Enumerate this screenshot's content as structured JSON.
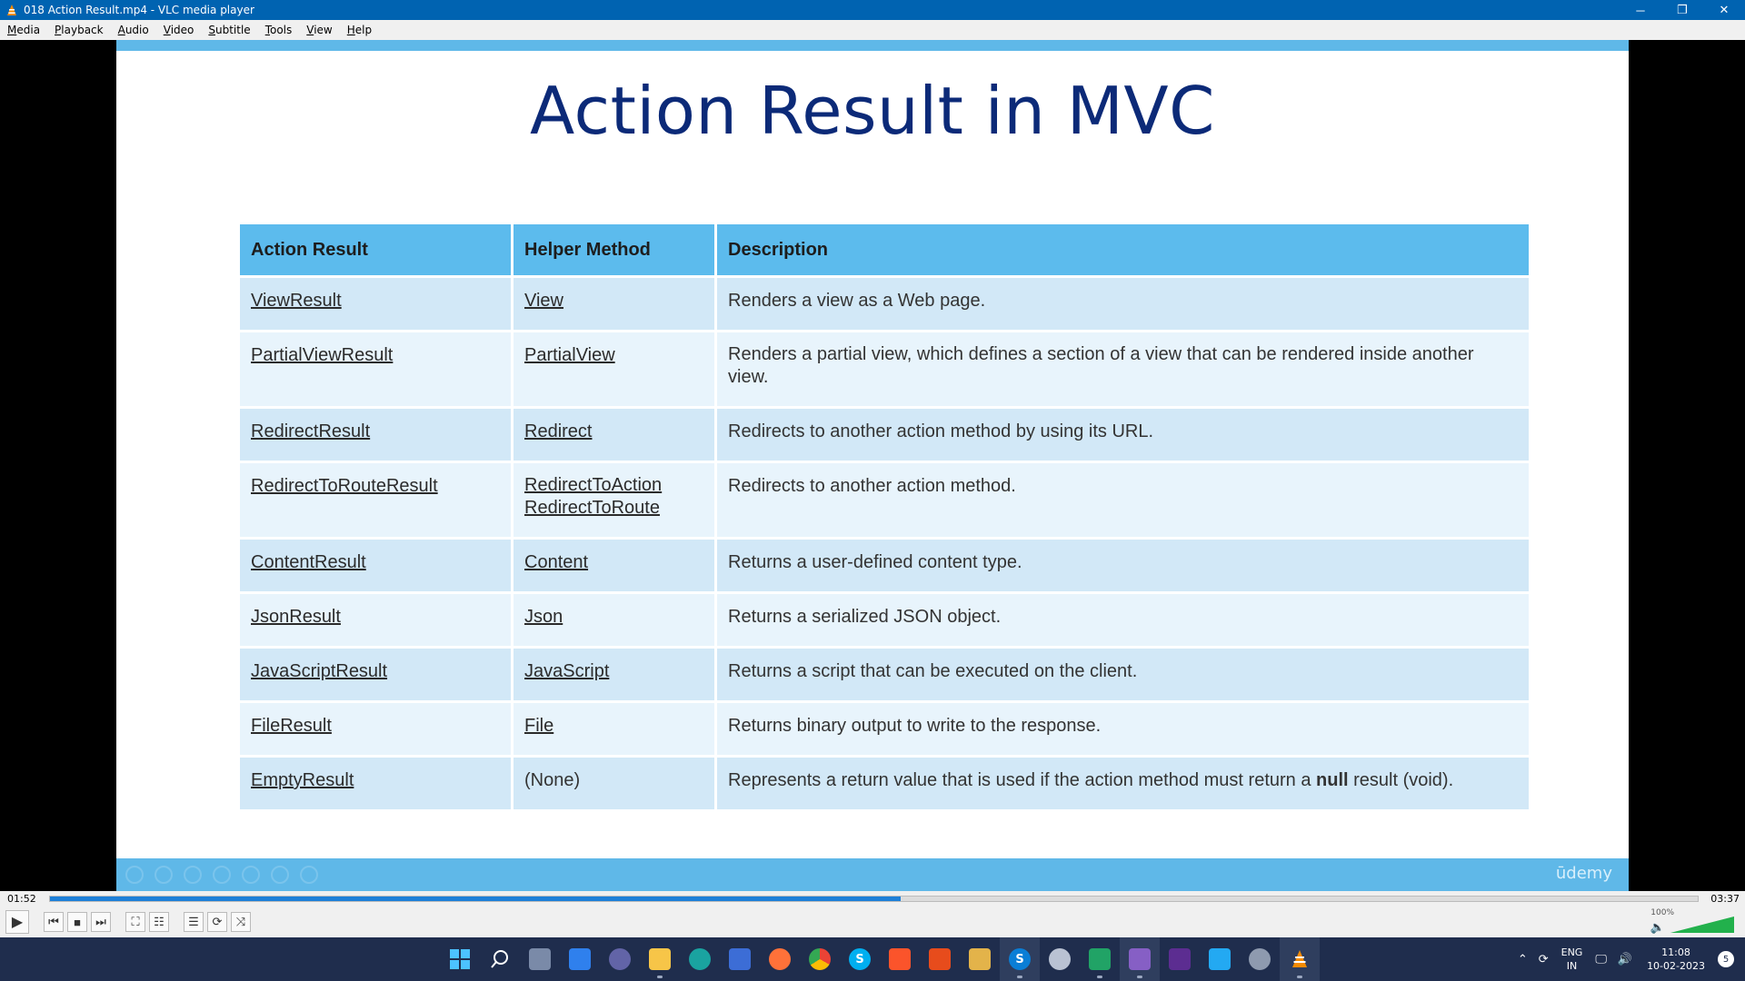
{
  "window": {
    "title": "018 Action Result.mp4 - VLC media player",
    "minimize_glyph": "─",
    "restore_glyph": "❐",
    "close_glyph": "✕"
  },
  "menu": [
    "Media",
    "Playback",
    "Audio",
    "Video",
    "Subtitle",
    "Tools",
    "View",
    "Help"
  ],
  "slide": {
    "title": "Action Result in MVC",
    "brand": "ūdemy",
    "table": {
      "headers": [
        "Action Result",
        "Helper Method",
        "Description"
      ],
      "rows": [
        {
          "result": "ViewResult",
          "helper": "View",
          "desc": "Renders a view as a Web page."
        },
        {
          "result": "PartialViewResult",
          "helper": "PartialView",
          "desc": "Renders a partial view, which defines a section of a view that can be rendered inside another view."
        },
        {
          "result": "RedirectResult",
          "helper": "Redirect",
          "desc": "Redirects to another action method by using its URL."
        },
        {
          "result": "RedirectToRouteResult",
          "helper": "RedirectToAction",
          "helper2": "RedirectToRoute",
          "desc": "Redirects to another action method."
        },
        {
          "result": "ContentResult",
          "helper": "Content",
          "desc": "Returns a user-defined content type."
        },
        {
          "result": "JsonResult",
          "helper": "Json",
          "desc": "Returns a serialized JSON object."
        },
        {
          "result": "JavaScriptResult",
          "helper": "JavaScript",
          "desc": "Returns a script that can be executed on the client."
        },
        {
          "result": "FileResult",
          "helper": "File",
          "desc": "Returns binary output to write to the response."
        },
        {
          "result": "EmptyResult",
          "helper": "(None)",
          "desc_pre": "Represents a return value that is used if the action method must return a ",
          "desc_bold": "null",
          "desc_post": " result (void)."
        }
      ]
    }
  },
  "player": {
    "elapsed": "01:52",
    "total": "03:37",
    "progress_fraction": 0.516,
    "volume": "100%",
    "volume_fraction": 1.0
  },
  "taskbar": {
    "lang_line1": "ENG",
    "lang_line2": "IN",
    "time": "11:08",
    "date": "10-02-2023",
    "notification_count": "5"
  }
}
